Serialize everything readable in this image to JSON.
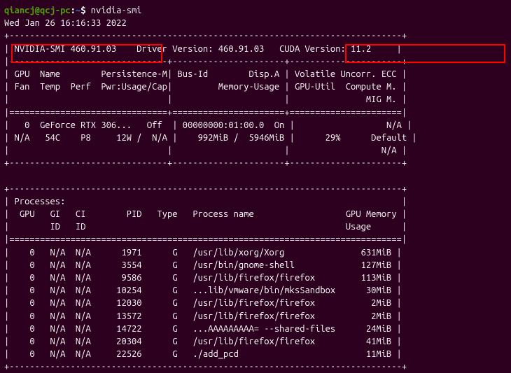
{
  "prompt": {
    "user_host": "qiancj@qcj-pc",
    "colon": ":",
    "path": "~",
    "dollar": "$ ",
    "command": "nvidia-smi"
  },
  "timestamp": "Wed Jan 26 16:16:33 2022",
  "header": {
    "smi": "NVIDIA-SMI 460.91.03",
    "driver": "Driver Version: 460.91.03",
    "cuda": "CUDA Version: 11.2"
  },
  "gpu_table_header": {
    "line1_left": "GPU  Name        Persistence-M",
    "line1_mid": "Bus-Id        Disp.A",
    "line1_right": "Volatile Uncorr. ECC",
    "line2_left": "Fan  Temp  Perf  Pwr:Usage/Cap",
    "line2_mid": "Memory-Usage",
    "line2_right": "GPU-Util  Compute M.",
    "line3_right": "MIG M."
  },
  "gpu_row": {
    "idx": "0",
    "name": "GeForce RTX 306...",
    "persist": "Off",
    "busid": "00000000:01:00.0",
    "dispA": "On",
    "ecc": "N/A",
    "fan": "N/A",
    "temp": "54C",
    "perf": "P8",
    "pwr": "12W /  N/A",
    "mem": "992MiB /  5946MiB",
    "util": "29%",
    "compute": "Default",
    "mig": "N/A"
  },
  "proc_header": {
    "title": "Processes:",
    "cols1": "GPU   GI   CI        PID   Type   Process name                  GPU Memory",
    "cols2": "      ID   ID                                                   Usage"
  },
  "processes": [
    {
      "gpu": "0",
      "gi": "N/A",
      "ci": "N/A",
      "pid": "1971",
      "type": "G",
      "name": "/usr/lib/xorg/Xorg",
      "mem": "631MiB"
    },
    {
      "gpu": "0",
      "gi": "N/A",
      "ci": "N/A",
      "pid": "3554",
      "type": "G",
      "name": "/usr/bin/gnome-shell",
      "mem": "127MiB"
    },
    {
      "gpu": "0",
      "gi": "N/A",
      "ci": "N/A",
      "pid": "9586",
      "type": "G",
      "name": "/usr/lib/firefox/firefox",
      "mem": "113MiB"
    },
    {
      "gpu": "0",
      "gi": "N/A",
      "ci": "N/A",
      "pid": "10254",
      "type": "G",
      "name": "...lib/vmware/bin/mksSandbox",
      "mem": "30MiB"
    },
    {
      "gpu": "0",
      "gi": "N/A",
      "ci": "N/A",
      "pid": "12030",
      "type": "G",
      "name": "/usr/lib/firefox/firefox",
      "mem": "2MiB"
    },
    {
      "gpu": "0",
      "gi": "N/A",
      "ci": "N/A",
      "pid": "13572",
      "type": "G",
      "name": "/usr/lib/firefox/firefox",
      "mem": "2MiB"
    },
    {
      "gpu": "0",
      "gi": "N/A",
      "ci": "N/A",
      "pid": "14722",
      "type": "G",
      "name": "...AAAAAAAAA= --shared-files",
      "mem": "24MiB"
    },
    {
      "gpu": "0",
      "gi": "N/A",
      "ci": "N/A",
      "pid": "20304",
      "type": "G",
      "name": "/usr/lib/firefox/firefox",
      "mem": "41MiB"
    },
    {
      "gpu": "0",
      "gi": "N/A",
      "ci": "N/A",
      "pid": "22526",
      "type": "G",
      "name": "./add_pcd",
      "mem": "11MiB"
    }
  ]
}
